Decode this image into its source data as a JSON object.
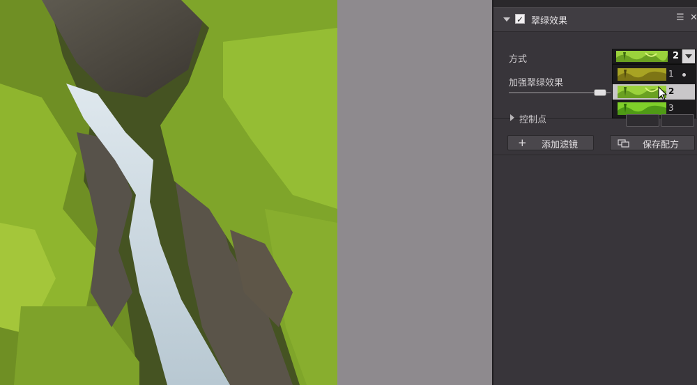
{
  "filter": {
    "title": "翠绿效果",
    "enabled": true,
    "menu_glyph": "☰",
    "close_glyph": "✕"
  },
  "method": {
    "label": "方式",
    "value": "2",
    "options": [
      {
        "label": "1",
        "selected": false
      },
      {
        "label": "2",
        "selected": true
      },
      {
        "label": "3",
        "selected": false
      }
    ]
  },
  "enhance": {
    "label": "加强翠绿效果",
    "level": 0.9
  },
  "control_points": {
    "label": "控制点"
  },
  "buttons": {
    "add_filter": "添加滤镜",
    "add_icon": "+",
    "save_recipe": "保存配方"
  },
  "colors": {
    "panel_bg": "#38353a",
    "canvas_bg": "#8e8a8e",
    "thumb_green": "#8fc83a"
  },
  "icons": [
    "expand-triangle-icon",
    "checkbox-check-icon",
    "menu-icon",
    "close-icon",
    "dropdown-arrow-icon",
    "mouse-cursor-icon",
    "plus-icon",
    "save-recipe-icon"
  ]
}
